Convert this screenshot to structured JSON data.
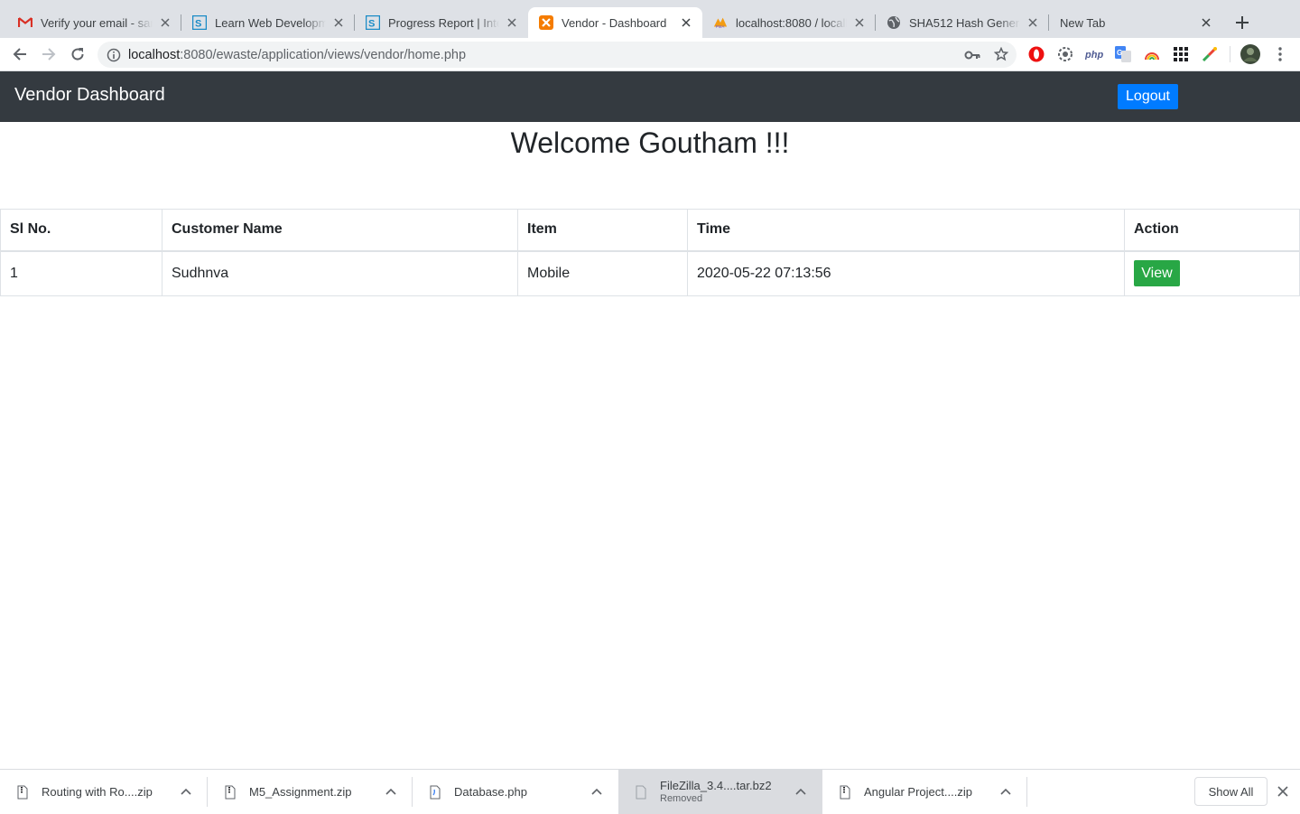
{
  "browser": {
    "tabs": [
      {
        "title": "Verify your email - sandhya",
        "icon": "gmail-icon"
      },
      {
        "title": "Learn Web Development",
        "icon": "is-logo-icon"
      },
      {
        "title": "Progress Report | Internshala",
        "icon": "is-logo-icon"
      },
      {
        "title": "Vendor - Dashboard",
        "icon": "xampp-icon",
        "active": true
      },
      {
        "title": "localhost:8080 / localhost",
        "icon": "phpmyadmin-icon"
      },
      {
        "title": "SHA512 Hash Generator",
        "icon": "globe-icon"
      },
      {
        "title": "New Tab",
        "icon": ""
      }
    ],
    "url_host": "localhost",
    "url_rest": ":8080/ewaste/application/views/vendor/home.php"
  },
  "navbar": {
    "brand": "Vendor Dashboard",
    "logout_label": "Logout"
  },
  "welcome": "Welcome Goutham !!!",
  "table": {
    "headers": [
      "Sl No.",
      "Customer Name",
      "Item",
      "Time",
      "Action"
    ],
    "rows": [
      {
        "sl": "1",
        "customer": "Sudhnva",
        "item": "Mobile",
        "time": "2020-05-22 07:13:56",
        "action": "View"
      }
    ]
  },
  "downloads": {
    "items": [
      {
        "name": "Routing with Ro....zip",
        "status": ""
      },
      {
        "name": "M5_Assignment.zip",
        "status": ""
      },
      {
        "name": "Database.php",
        "status": ""
      },
      {
        "name": "FileZilla_3.4....tar.bz2",
        "status": "Removed"
      },
      {
        "name": "Angular Project....zip",
        "status": ""
      }
    ],
    "show_all": "Show All"
  },
  "colors": {
    "navbar_bg": "#343a40",
    "logout_bg": "#007bff",
    "view_bg": "#28a745"
  }
}
